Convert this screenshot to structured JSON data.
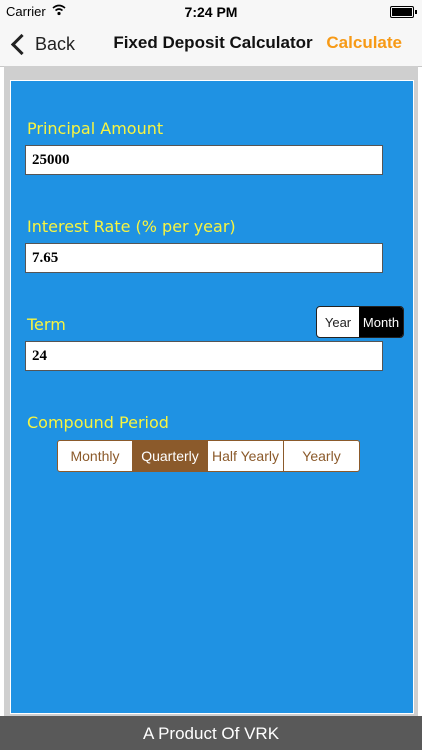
{
  "status_bar": {
    "carrier": "Carrier",
    "time": "7:24 PM"
  },
  "nav": {
    "back_label": "Back",
    "title": "Fixed Deposit Calculator",
    "action_label": "Calculate"
  },
  "form": {
    "principal": {
      "label": "Principal Amount",
      "value": "25000"
    },
    "interest": {
      "label": "Interest Rate (% per year)",
      "value": "7.65"
    },
    "term": {
      "label": "Term",
      "value": "24",
      "units": [
        "Year",
        "Month"
      ],
      "selected_unit": "Month"
    },
    "compound": {
      "label": "Compound Period",
      "options": [
        "Monthly",
        "Quarterly",
        "Half Yearly",
        "Yearly"
      ],
      "selected": "Quarterly"
    }
  },
  "footer": {
    "text": "A Product Of VRK"
  },
  "colors": {
    "panel": "#1f92e3",
    "label": "#f8f440",
    "accent": "#f79a16",
    "segment": "#8b5a2b"
  }
}
